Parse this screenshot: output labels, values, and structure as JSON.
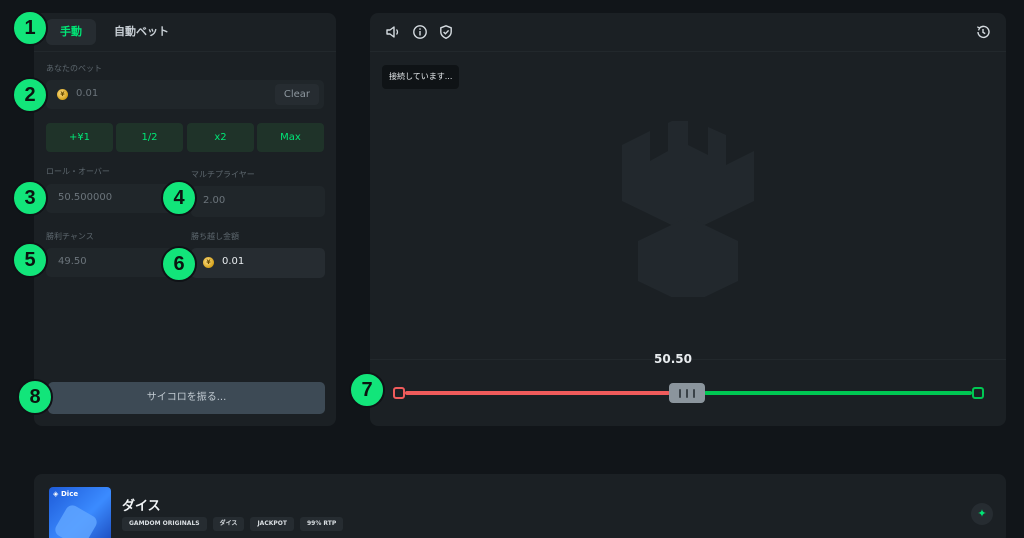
{
  "tabs": [
    {
      "label": "手動",
      "active": true
    },
    {
      "label": "自動ベット",
      "active": false
    }
  ],
  "bet": {
    "label": "あなたのベット",
    "value": "0.01",
    "clear_label": "Clear",
    "coin_icon": "yen-coin-icon"
  },
  "quick_buttons": [
    "+¥1",
    "1/2",
    "x2",
    "Max"
  ],
  "roll_over": {
    "label": "ロール・オーバー",
    "value": "50.500000"
  },
  "multiplier": {
    "label": "マルチプライヤー",
    "value": "2.00"
  },
  "win_chance": {
    "label": "勝利チャンス",
    "value": "49.50"
  },
  "profit": {
    "label": "勝ち越し金額",
    "value": "0.01"
  },
  "roll_button": "サイコロを振る...",
  "toolbar_icons": [
    "sound-icon",
    "info-icon",
    "shield-check-icon",
    "history-icon"
  ],
  "toast": "接続しています...",
  "slider": {
    "value": "50.50",
    "position": 0.505
  },
  "badges": [
    "1",
    "2",
    "3",
    "4",
    "5",
    "6",
    "7",
    "8"
  ],
  "game_info": {
    "thumb_label": "Dice",
    "title": "ダイス",
    "tags": [
      "GAMDOM ORIGINALS",
      "ダイス",
      "JACKPOT",
      "99% RTP"
    ],
    "fav_icon": "sparkle-icon"
  },
  "colors": {
    "accent": "#00e676",
    "badge": "#12e57a",
    "lose_bar": "#ef5b5b",
    "win_bar": "#00c853",
    "panel": "#1b2024",
    "background": "#111519"
  }
}
